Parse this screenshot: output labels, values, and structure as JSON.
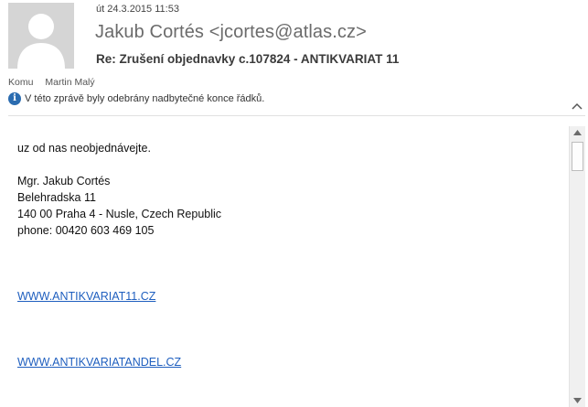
{
  "header": {
    "date": "út 24.3.2015 11:53",
    "sender": "Jakub Cortés <jcortes@atlas.cz>",
    "subject": "Re: Zrušení objednavky c.107824 - ANTIKVARIAT 11"
  },
  "recipients": {
    "label": "Komu",
    "name": "Martin Malý"
  },
  "info_bar": {
    "icon": "info-icon",
    "text": "V této zprávě byly odebrány nadbytečné konce řádků."
  },
  "body": {
    "line1": "uz od nas neobjednávejte.",
    "signature": {
      "name": "Mgr. Jakub Cortés",
      "street": "Belehradska 11",
      "city": "140 00 Praha 4 - Nusle, Czech Republic",
      "phone": "phone: 00420 603 469 105"
    },
    "link1": "WWW.ANTIKVARIAT11.CZ",
    "link2": "WWW.ANTIKVARIATANDEL.CZ"
  },
  "colors": {
    "link": "#1f5fbf",
    "info_icon": "#2b6cb0"
  }
}
